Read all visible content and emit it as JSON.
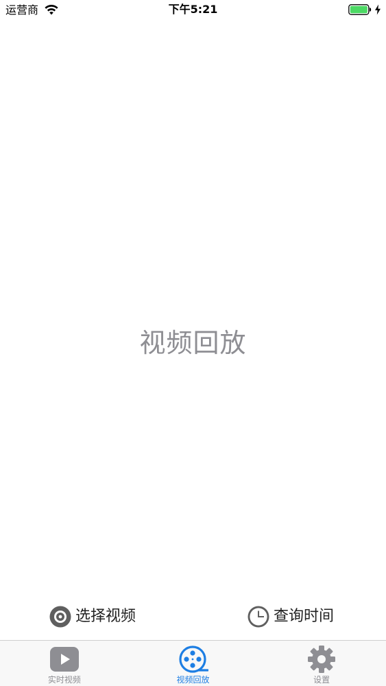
{
  "status_bar": {
    "carrier": "运营商",
    "time": "下午5:21",
    "icons": [
      "wifi-icon",
      "battery-icon",
      "charging-icon"
    ]
  },
  "main": {
    "title": "视频回放"
  },
  "actions": [
    {
      "label": "选择视频",
      "icon": "disc-icon"
    },
    {
      "label": "查询时间",
      "icon": "clock-icon"
    }
  ],
  "tab_bar": {
    "active_index": 1,
    "tabs": [
      {
        "label": "实时视频",
        "icon": "play-icon"
      },
      {
        "label": "视频回放",
        "icon": "film-reel-icon"
      },
      {
        "label": "设置",
        "icon": "gear-icon"
      }
    ]
  },
  "colors": {
    "accent": "#1d7ee3",
    "inactive": "#8e8e93",
    "title_gray": "#8e8e93",
    "battery_green": "#4cd964"
  }
}
